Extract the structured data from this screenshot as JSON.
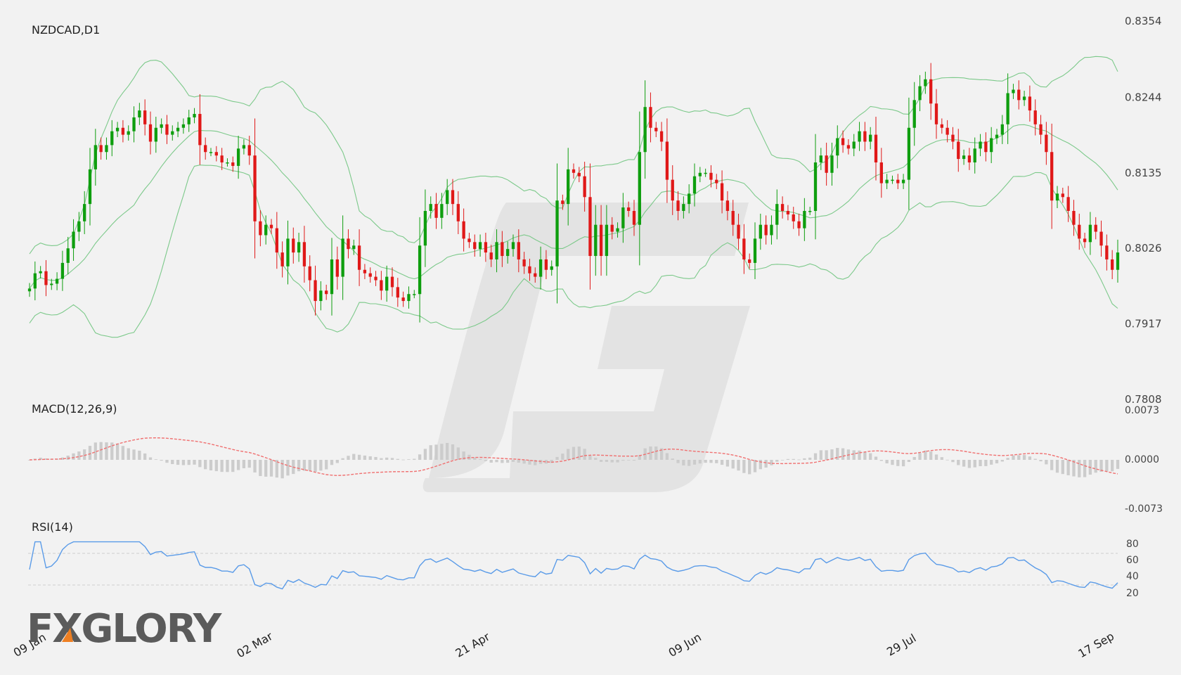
{
  "chart_data": {
    "type": "candlestick",
    "title": "NZDCAD,D1",
    "symbol": "NZDCAD",
    "timeframe": "D1",
    "price_axis": {
      "ticks": [
        "0.8354",
        "0.8244",
        "0.8135",
        "0.8026",
        "0.7917",
        "0.7808"
      ],
      "ylim": [
        0.7808,
        0.8354
      ]
    },
    "x_ticks": [
      "09 Jan",
      "02 Mar",
      "21 Apr",
      "09 Jun",
      "29 Jul",
      "17 Sep"
    ],
    "colors": {
      "bull": "#0e9e0e",
      "bear": "#e01818",
      "bollinger": "#7cc98a",
      "macd_signal": "#f07070",
      "macd_hist": "#cccccc",
      "rsi": "#5a9be8",
      "watermark": "#e2e2e2"
    },
    "close": [
      0.7968,
      0.799,
      0.7993,
      0.7973,
      0.7975,
      0.7982,
      0.8005,
      0.8026,
      0.805,
      0.8065,
      0.809,
      0.814,
      0.8175,
      0.8165,
      0.8175,
      0.8195,
      0.82,
      0.819,
      0.8195,
      0.8215,
      0.8225,
      0.8205,
      0.818,
      0.82,
      0.8205,
      0.819,
      0.8195,
      0.82,
      0.8205,
      0.8215,
      0.822,
      0.8175,
      0.8165,
      0.8165,
      0.816,
      0.815,
      0.815,
      0.8145,
      0.817,
      0.8175,
      0.816,
      0.8065,
      0.8045,
      0.806,
      0.8055,
      0.802,
      0.8,
      0.804,
      0.802,
      0.8035,
      0.8,
      0.798,
      0.795,
      0.7965,
      0.796,
      0.801,
      0.7985,
      0.804,
      0.8025,
      0.803,
      0.7995,
      0.799,
      0.7985,
      0.798,
      0.7965,
      0.7985,
      0.797,
      0.7955,
      0.795,
      0.796,
      0.796,
      0.803,
      0.808,
      0.809,
      0.807,
      0.809,
      0.811,
      0.809,
      0.8065,
      0.804,
      0.8035,
      0.8025,
      0.8035,
      0.802,
      0.801,
      0.8035,
      0.8015,
      0.8025,
      0.8035,
      0.801,
      0.8,
      0.799,
      0.7985,
      0.801,
      0.7995,
      0.8,
      0.8095,
      0.809,
      0.814,
      0.8135,
      0.813,
      0.81,
      0.8015,
      0.806,
      0.8015,
      0.806,
      0.805,
      0.8055,
      0.8085,
      0.808,
      0.806,
      0.8165,
      0.823,
      0.82,
      0.8195,
      0.818,
      0.8125,
      0.8095,
      0.808,
      0.809,
      0.8105,
      0.813,
      0.8135,
      0.8135,
      0.8125,
      0.812,
      0.8095,
      0.808,
      0.806,
      0.804,
      0.801,
      0.8005,
      0.804,
      0.806,
      0.8045,
      0.806,
      0.809,
      0.808,
      0.8075,
      0.8065,
      0.8055,
      0.808,
      0.808,
      0.815,
      0.816,
      0.8135,
      0.816,
      0.8185,
      0.8175,
      0.817,
      0.818,
      0.8195,
      0.818,
      0.819,
      0.815,
      0.812,
      0.8125,
      0.8125,
      0.812,
      0.8125,
      0.82,
      0.824,
      0.826,
      0.827,
      0.8235,
      0.8205,
      0.82,
      0.819,
      0.818,
      0.8155,
      0.816,
      0.815,
      0.817,
      0.818,
      0.8165,
      0.8185,
      0.819,
      0.8205,
      0.825,
      0.8255,
      0.824,
      0.8245,
      0.8225,
      0.8205,
      0.819,
      0.8165,
      0.8095,
      0.8105,
      0.81,
      0.808,
      0.806,
      0.804,
      0.8035,
      0.806,
      0.805,
      0.803,
      0.801,
      0.7995,
      0.802
    ]
  }
}
